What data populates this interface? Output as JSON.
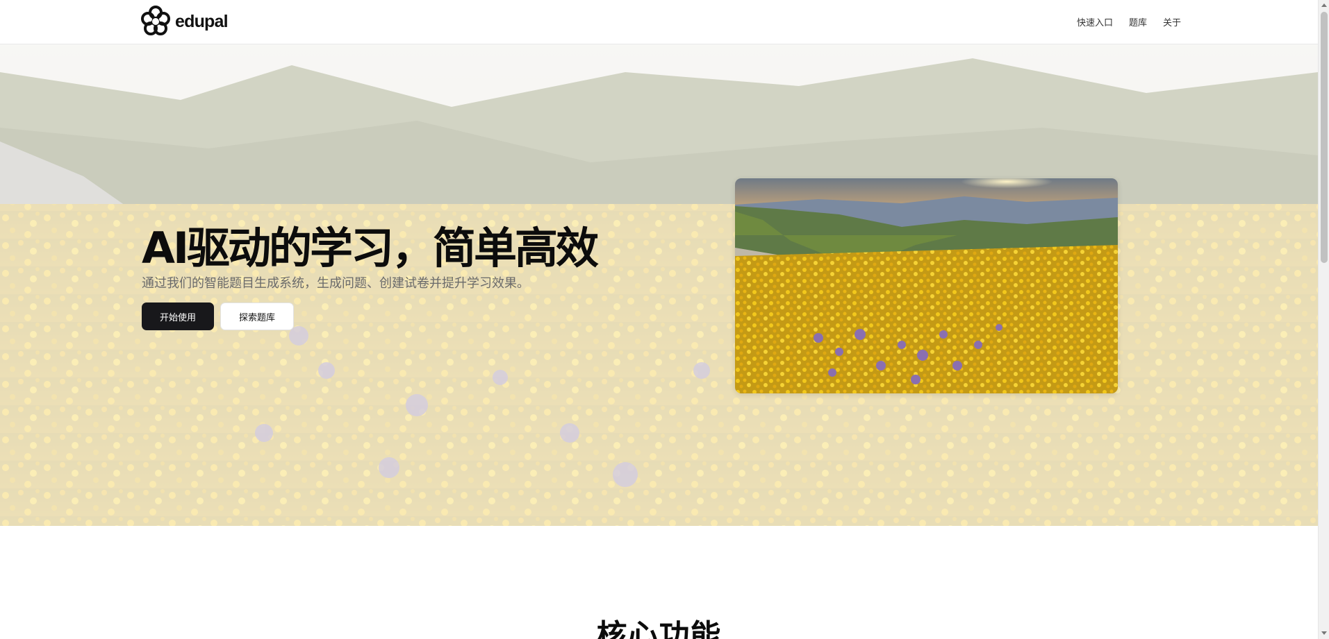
{
  "brand": {
    "name": "edupal"
  },
  "nav": {
    "items": [
      "快速入口",
      "题库",
      "关于"
    ]
  },
  "hero": {
    "title": "AI驱动的学习，简单高效",
    "subtitle": "通过我们的智能题目生成系统，生成问题、创建试卷并提升学习效果。",
    "primary_button": "开始使用",
    "secondary_button": "探索题库"
  },
  "section": {
    "title": "核心功能"
  },
  "colors": {
    "primary": "#18181b",
    "accent_flowers": "#e8b81c"
  },
  "icons": {
    "logo": "flower-logo-icon"
  }
}
